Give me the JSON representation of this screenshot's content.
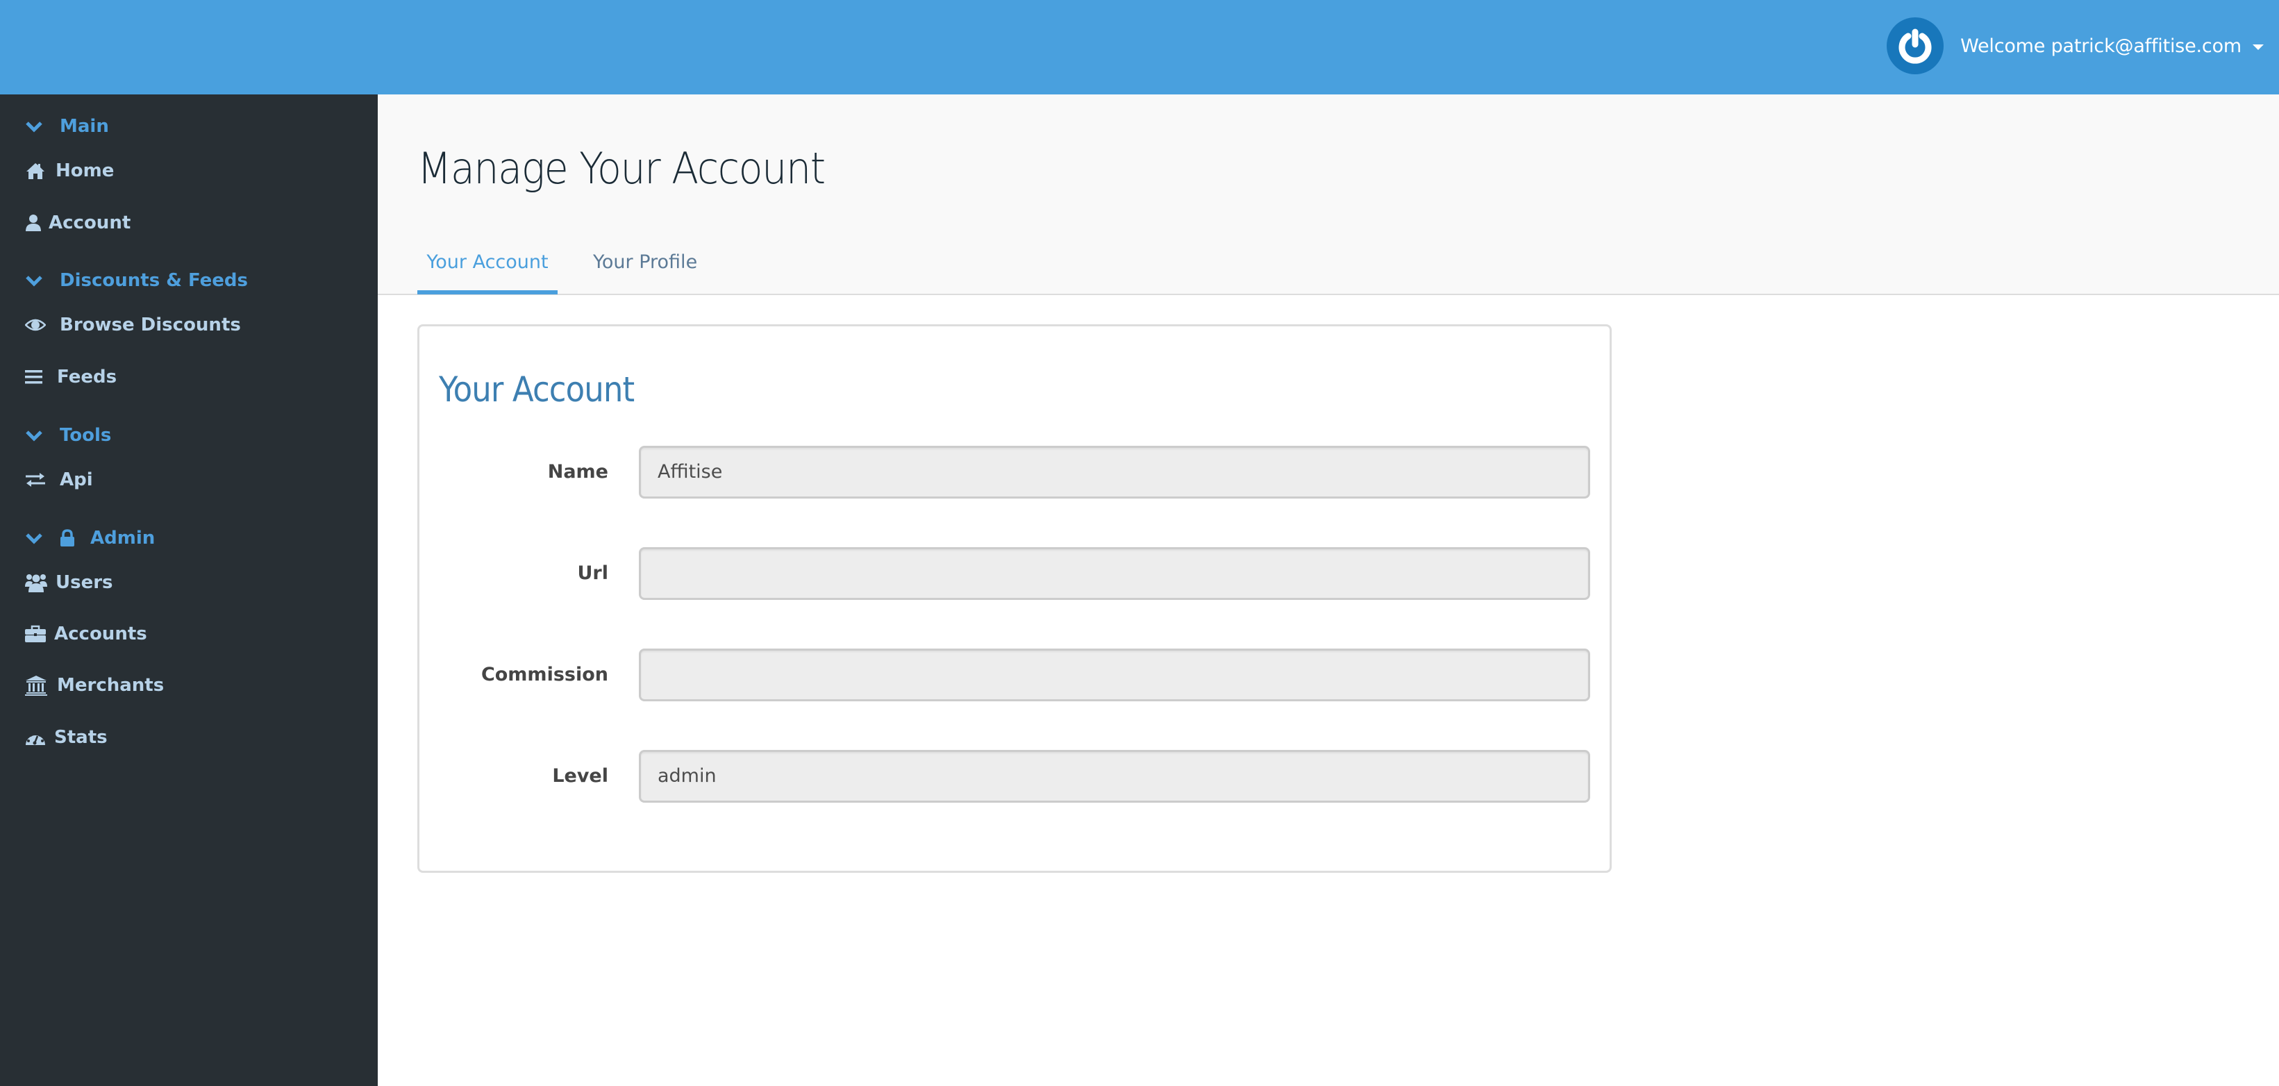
{
  "header": {
    "welcome_text": "Welcome patrick@affitise.com",
    "logo_icon": "power-icon",
    "menu_caret_icon": "caret-down-icon"
  },
  "sidebar": {
    "sections": [
      {
        "label": "Main",
        "icon": "chevron-down-icon",
        "items": [
          {
            "label": "Home",
            "icon": "home-icon"
          },
          {
            "label": "Account",
            "icon": "user-icon"
          }
        ]
      },
      {
        "label": "Discounts & Feeds",
        "icon": "chevron-down-icon",
        "items": [
          {
            "label": "Browse Discounts",
            "icon": "eye-icon"
          },
          {
            "label": "Feeds",
            "icon": "list-icon"
          }
        ]
      },
      {
        "label": "Tools",
        "icon": "chevron-down-icon",
        "items": [
          {
            "label": "Api",
            "icon": "exchange-icon"
          }
        ]
      },
      {
        "label": "Admin",
        "icon": "chevron-down-icon",
        "secondary_icon": "lock-icon",
        "items": [
          {
            "label": "Users",
            "icon": "users-icon"
          },
          {
            "label": "Accounts",
            "icon": "briefcase-icon"
          },
          {
            "label": "Merchants",
            "icon": "bank-icon"
          },
          {
            "label": "Stats",
            "icon": "dashboard-icon"
          }
        ]
      }
    ]
  },
  "main": {
    "page_title": "Manage Your Account",
    "tabs": [
      {
        "label": "Your Account",
        "active": true
      },
      {
        "label": "Your Profile",
        "active": false
      }
    ],
    "card": {
      "title": "Your Account",
      "fields": [
        {
          "label": "Name",
          "value": "Affitise"
        },
        {
          "label": "Url",
          "value": ""
        },
        {
          "label": "Commission",
          "value": ""
        },
        {
          "label": "Level",
          "value": "admin"
        }
      ]
    }
  },
  "colors": {
    "topbar": "#49a0de",
    "sidebar": "#282f34",
    "sidebar_section": "#4e9fdd",
    "sidebar_item": "#b7d2e8",
    "accent": "#4a9fdd",
    "card_title": "#3d7fb1"
  }
}
